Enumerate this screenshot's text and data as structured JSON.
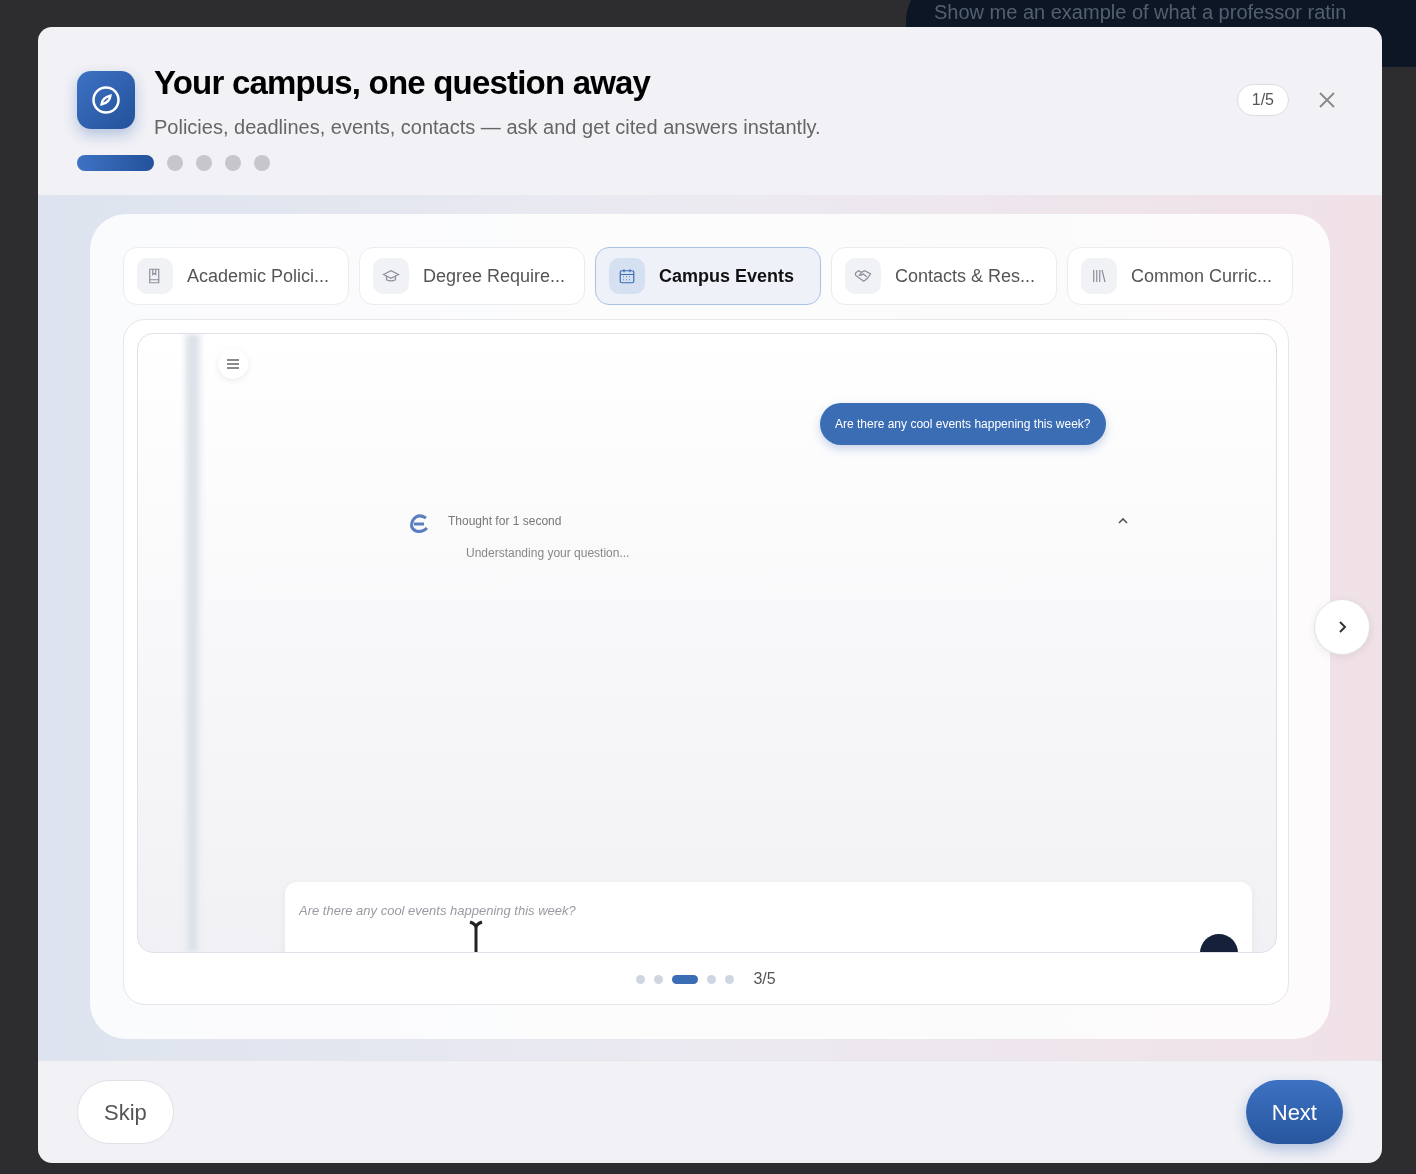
{
  "background": {
    "prompt_text": "Show me an example of what a professor ratin"
  },
  "dialog": {
    "title": "Your campus, one question away",
    "subtitle": "Policies, deadlines, events, contacts — ask and get cited answers instantly.",
    "step_badge": "1/5",
    "steps": [
      {
        "selected": true
      },
      {
        "selected": false
      },
      {
        "selected": false
      },
      {
        "selected": false
      },
      {
        "selected": false
      }
    ]
  },
  "tabs": [
    {
      "label": "Academic Polici...",
      "kind": "book",
      "selected": false
    },
    {
      "label": "Degree Require...",
      "kind": "cap",
      "selected": false
    },
    {
      "label": "Campus Events",
      "kind": "calendar",
      "selected": true
    },
    {
      "label": "Contacts & Res...",
      "kind": "handshake",
      "selected": false
    },
    {
      "label": "Common Curric...",
      "kind": "library",
      "selected": false
    }
  ],
  "preview": {
    "user_message": "Are there any cool events happening this week?",
    "thinking": [
      "Thought for 1 second",
      "Understanding your question..."
    ],
    "input_value": "Are there any cool events happening this week?",
    "slides": [
      {
        "selected": false
      },
      {
        "selected": false
      },
      {
        "selected": true
      },
      {
        "selected": false
      },
      {
        "selected": false
      }
    ],
    "slide_counter": "3/5"
  },
  "footer": {
    "skip": "Skip",
    "next": "Next"
  }
}
